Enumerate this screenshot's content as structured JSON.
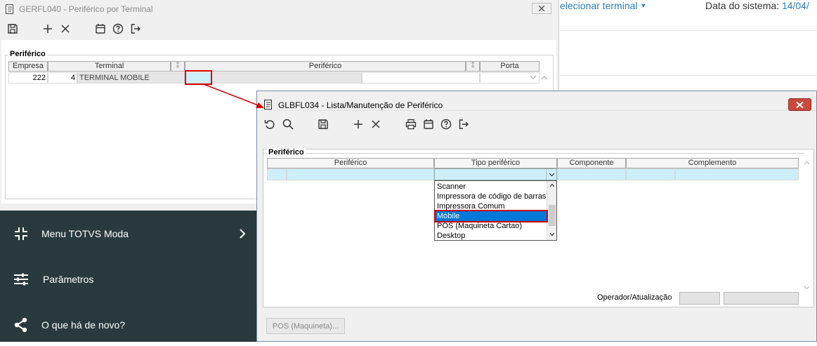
{
  "win1": {
    "title": "GERFL040 - Periférico por Terminal",
    "toolbar": [
      "save-icon",
      "plus-icon",
      "close-icon",
      "calendar-icon",
      "help-icon",
      "exit-icon"
    ],
    "group_label": "Periférico",
    "columns": {
      "empresa": "Empresa",
      "terminal": "Terminal",
      "periferico": "Periférico",
      "porta": "Porta"
    },
    "row": {
      "empresa": "222",
      "terminal_num": "4",
      "terminal_name": "TERMINAL MOBILE",
      "periferico": "",
      "porta": ""
    }
  },
  "right": {
    "link": "elecionar terminal",
    "date_label": "Data do sistema: ",
    "date_value": "14/04/"
  },
  "sidebar": {
    "items": [
      {
        "label": "Menu TOTVS Moda",
        "icon": "compress-icon"
      },
      {
        "label": "Parâmetros",
        "icon": "sliders-icon"
      },
      {
        "label": "O que há de novo?",
        "icon": "share-icon"
      }
    ]
  },
  "win2": {
    "title": "GLBFL034 - Lista/Manutenção de Periférico",
    "toolbar": [
      "undo-icon",
      "search-icon",
      "save-icon",
      "plus-icon",
      "close-icon",
      "print-icon",
      "calendar-icon",
      "help-icon",
      "exit-icon"
    ],
    "group_label": "Periférico",
    "columns": {
      "periferico": "Periférico",
      "tipo": "Tipo periférico",
      "componente": "Componente",
      "complemento": "Complemento"
    },
    "dropdown_options": [
      "Scanner",
      "Impressora de código de barras",
      "Impressora Comum",
      "Móbile",
      "POS (Maquineta Cartao)",
      "Desktop"
    ],
    "selected_option": "Móbile",
    "operator_label": "Operador/Atualização",
    "pos_button": "POS (Maquineta)..."
  },
  "colors": {
    "highlight": "#0078d7",
    "annotation": "#d40000",
    "sidebar": "#2a3a3c",
    "link": "#2c7fb8",
    "cell_bg": "#cdeffa"
  }
}
